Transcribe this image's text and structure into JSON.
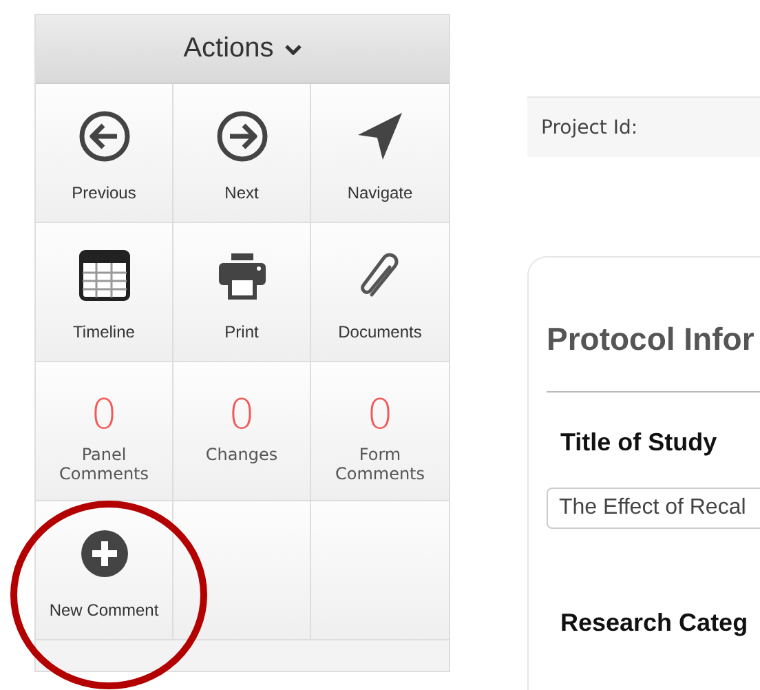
{
  "actions_panel": {
    "title": "Actions",
    "tiles": [
      {
        "kind": "icon",
        "label": "Previous"
      },
      {
        "kind": "icon",
        "label": "Next"
      },
      {
        "kind": "icon",
        "label": "Navigate"
      },
      {
        "kind": "icon",
        "label": "Timeline"
      },
      {
        "kind": "icon",
        "label": "Print"
      },
      {
        "kind": "icon",
        "label": "Documents"
      },
      {
        "kind": "count",
        "count": "0",
        "label": "Panel Comments"
      },
      {
        "kind": "count",
        "count": "0",
        "label": "Changes"
      },
      {
        "kind": "count",
        "count": "0",
        "label": "Form Comments"
      },
      {
        "kind": "icon",
        "label": "New Comment"
      },
      {
        "kind": "empty"
      },
      {
        "kind": "empty"
      }
    ]
  },
  "project_bar": {
    "label": "Project Id:"
  },
  "protocol_card": {
    "heading": "Protocol Infor",
    "fields": [
      {
        "kind": "text",
        "label": "Title of Study",
        "value": "The Effect of Recal"
      },
      {
        "kind": "heading",
        "label": "Research Categ"
      }
    ]
  }
}
